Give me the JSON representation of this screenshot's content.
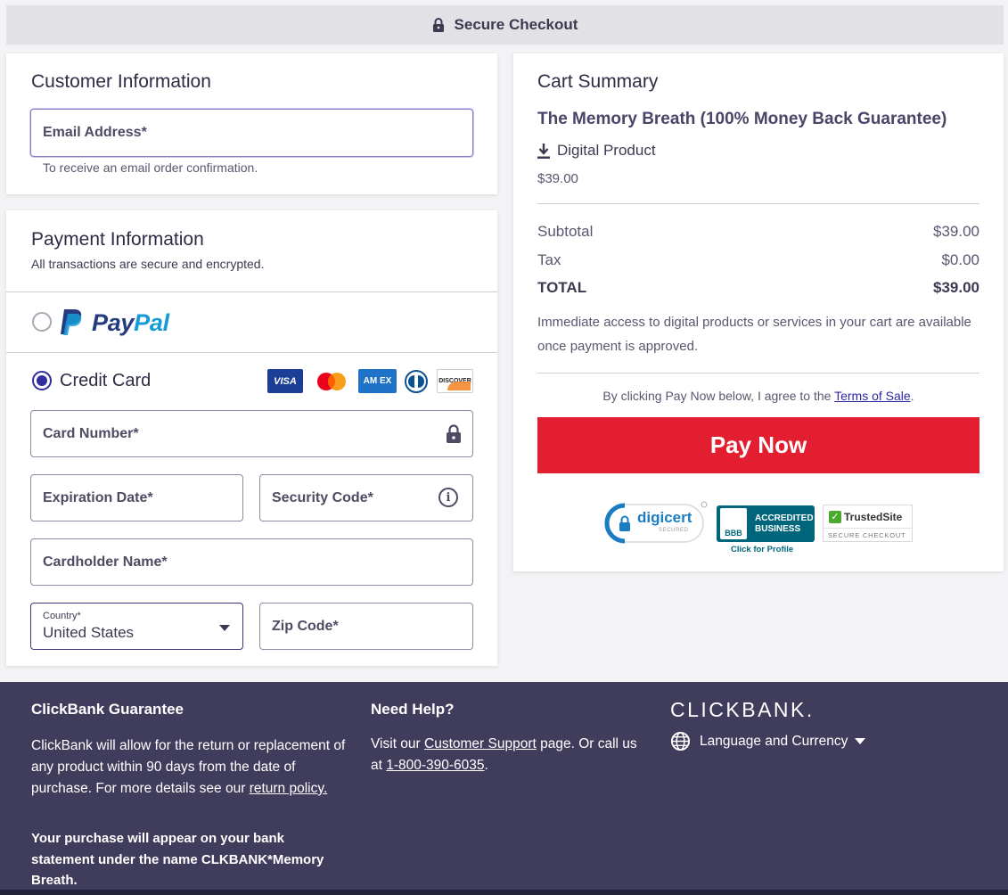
{
  "header": {
    "title": "Secure Checkout",
    "icon": "lock-icon"
  },
  "customer": {
    "title": "Customer Information",
    "email_placeholder": "Email Address*",
    "email_hint": "To receive an email order confirmation."
  },
  "payment": {
    "title": "Payment Information",
    "subtitle": "All transactions are secure and encrypted.",
    "paypal": {
      "pay": "Pay",
      "pal": "Pal",
      "selected": false
    },
    "credit_card": {
      "label": "Credit Card",
      "selected": true
    },
    "card_brands": [
      {
        "name": "visa",
        "text": "VISA"
      },
      {
        "name": "mastercard",
        "text": ""
      },
      {
        "name": "amex",
        "text": "AM EX"
      },
      {
        "name": "diners",
        "text": ""
      },
      {
        "name": "discover",
        "text": "DISCOVER"
      }
    ],
    "card_number": "Card Number*",
    "expiration": "Expiration Date*",
    "security_code": "Security Code*",
    "cardholder": "Cardholder Name*",
    "country_label": "Country*",
    "country_value": "United States",
    "zip": "Zip Code*"
  },
  "cart": {
    "title": "Cart Summary",
    "product_name": "The Memory Breath (100% Money Back Guarantee)",
    "product_type": "Digital Product",
    "product_price": "$39.00",
    "subtotal_label": "Subtotal",
    "subtotal": "$39.00",
    "tax_label": "Tax",
    "tax": "$0.00",
    "total_label": "TOTAL",
    "total": "$39.00",
    "access_note": "Immediate access to digital products or services in your cart are available once payment is approved.",
    "agree_prefix": "By clicking Pay Now below, I agree to the ",
    "agree_link": "Terms of Sale",
    "agree_suffix": ".",
    "pay_button": "Pay Now",
    "badges": {
      "digicert": "digicert",
      "digicert_sub": "SECURED",
      "bbb_line1": "ACCREDITED",
      "bbb_line2": "BUSINESS",
      "bbb_logo": "BBB",
      "bbb_click": "Click for Profile",
      "trusted": "TrustedSite",
      "trusted_sub": "SECURE CHECKOUT"
    }
  },
  "footer": {
    "guarantee_title": "ClickBank Guarantee",
    "guarantee_text": "ClickBank will allow for the return or replacement of any product within 90 days from the date of purchase. For more details see our",
    "return_policy": "return policy.",
    "statement_note": "Your purchase will appear on your bank statement under the name CLKBANK*Memory Breath.",
    "help_title": "Need Help?",
    "help_prefix": "Visit our ",
    "help_link": "Customer Support",
    "help_mid": " page. Or call us at ",
    "phone": "1-800-390-6035",
    "help_suffix": ".",
    "logo": "CLICKBANK.",
    "language": "Language and Currency"
  }
}
